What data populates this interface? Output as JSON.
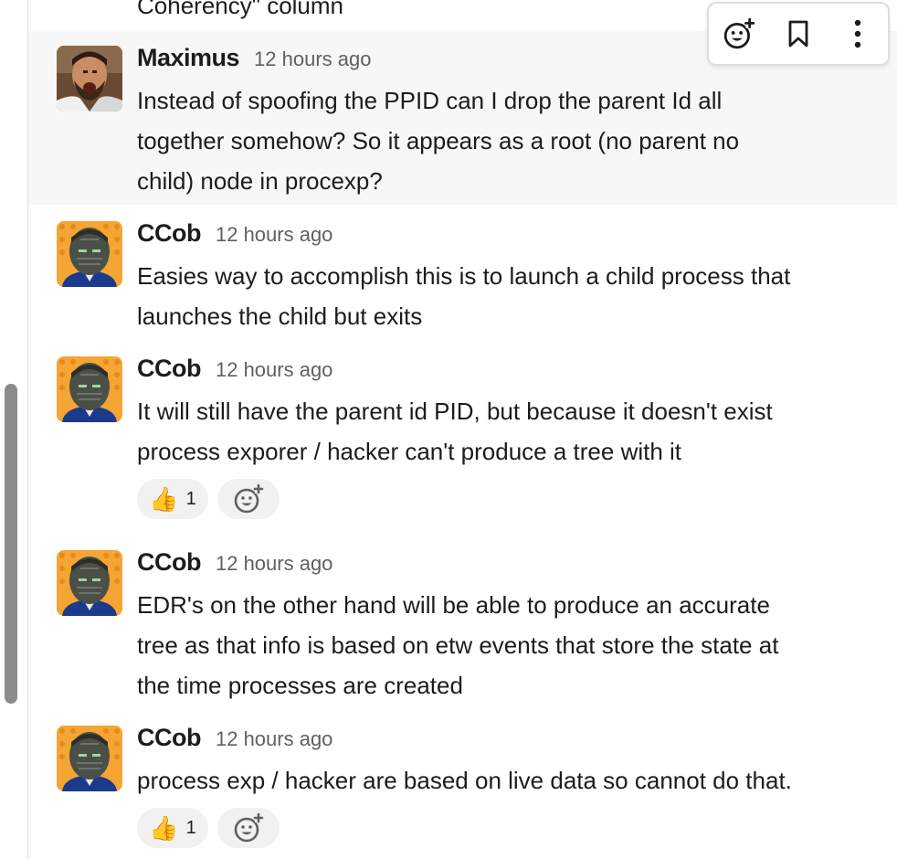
{
  "previous_message": {
    "tail_text": "Coherency\" column"
  },
  "toolbar": {
    "add_reaction_icon": "emoji-add-icon",
    "save_icon": "bookmark-icon",
    "more_icon": "more-vertical-icon"
  },
  "colors": {
    "reaction_bg": "#f1f1f1",
    "hover_bg": "#f7f7f7",
    "timestamp": "#616061",
    "text": "#1d1c1d"
  },
  "messages": [
    {
      "author": "Maximus",
      "time": "12 hours ago",
      "avatar": "maximus-avatar",
      "lines": [
        "Instead of spoofing the PPID can I drop the parent Id all",
        "together somehow?  So it appears as a root (no parent no",
        "child) node in procexp?"
      ]
    },
    {
      "author": "CCob",
      "time": "12 hours ago",
      "avatar": "ccob-avatar",
      "lines": [
        "Easies way to accomplish this is to launch a child process that",
        "launches the child but exits"
      ]
    },
    {
      "author": "CCob",
      "time": "12 hours ago",
      "avatar": "ccob-avatar",
      "lines": [
        "It will still have the parent id PID, but because it doesn't exist",
        "process exporer / hacker can't produce a tree with it"
      ],
      "reaction": {
        "emoji": "👍",
        "count": "1"
      }
    },
    {
      "author": "CCob",
      "time": "12 hours ago",
      "avatar": "ccob-avatar",
      "lines": [
        "EDR's on the other hand will be able to produce an accurate",
        "tree as that info is based on etw events that store the state at",
        "the time processes are created"
      ]
    },
    {
      "author": "CCob",
      "time": "12 hours ago",
      "avatar": "ccob-avatar",
      "lines": [
        "process exp / hacker are based on live data so cannot do that."
      ],
      "reaction": {
        "emoji": "👍",
        "count": "1"
      }
    }
  ]
}
